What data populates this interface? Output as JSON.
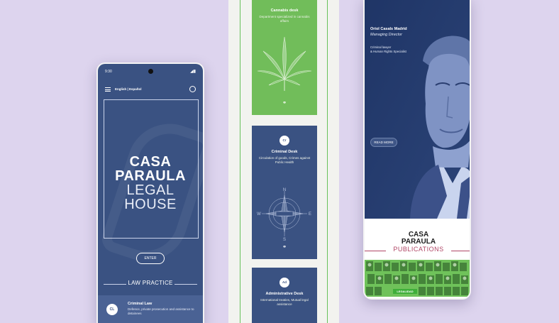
{
  "colors": {
    "background": "#ddd4ee",
    "navy": "#3a5282",
    "green": "#71bd5a",
    "publications_accent": "#b04666"
  },
  "phone_left": {
    "status": {
      "time": "9:30",
      "signal_icon": "signal-battery-icon"
    },
    "header": {
      "menu_icon": "hamburger-menu-icon",
      "language": "English | Español",
      "whatsapp_icon": "whatsapp-icon"
    },
    "hero": {
      "title_line1": "CASA",
      "title_line2": "PARAULA",
      "title_line3": "LEGAL",
      "title_line4": "HOUSE",
      "enter_label": "ENTER"
    },
    "section_title": "LAW PRACTICE",
    "practice_item": {
      "badge": "CL",
      "title": "Criminal Law",
      "description": "Defence, private prosecution and assistance to detainees"
    }
  },
  "middle_column": {
    "cards": [
      {
        "title": "Cannabis desk",
        "description": "Department specialized in cannabis affairs",
        "icon": "cannabis-leaf-icon",
        "link_icon": "link-icon"
      },
      {
        "badge": "Cr",
        "title": "Criminal Desk",
        "description": "Circulation of goods, Crimes against Public Health",
        "icon": "compass-rose-icon",
        "compass": {
          "n": "N",
          "s": "S",
          "e": "E",
          "w": "W"
        },
        "link_icon": "link-icon"
      },
      {
        "badge": "Ad",
        "title": "Administrative Desk",
        "description": "International treaties, Mutual legal assistance"
      }
    ]
  },
  "phone_right": {
    "profile": {
      "name": "Oriol Casals Madrid",
      "role": "Managing Director",
      "description_line1": "Criminal lawyer",
      "description_line2": "& Human Rights Specialist",
      "read_more": "READ MORE"
    },
    "publications": {
      "title_line1": "CASA",
      "title_line2": "PARAULA",
      "subtitle": "PUBLICATIONS",
      "ribbon": "LEGALIDAD"
    }
  }
}
